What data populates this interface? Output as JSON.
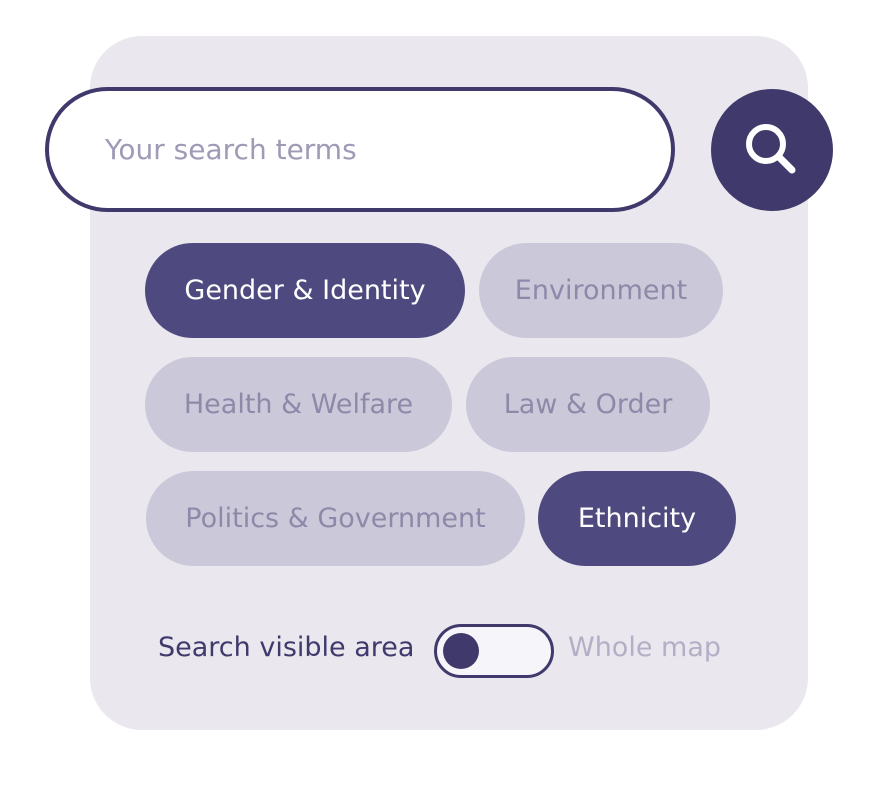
{
  "search": {
    "placeholder": "Your search terms",
    "value": "",
    "button_icon": "search-icon"
  },
  "categories": [
    {
      "label": "Gender & Identity",
      "selected": true
    },
    {
      "label": "Environment",
      "selected": false
    },
    {
      "label": "Health & Welfare",
      "selected": false
    },
    {
      "label": "Law & Order",
      "selected": false
    },
    {
      "label": "Politics & Government",
      "selected": false
    },
    {
      "label": "Ethnicity",
      "selected": true
    }
  ],
  "scope": {
    "left_label": "Search visible area",
    "right_label": "Whole map",
    "selected": "Search visible area"
  },
  "colors": {
    "primary": "#3f3a6b",
    "chip_active": "#4e4a7f",
    "chip_inactive": "#cbc9d9",
    "panel_bg": "#eae7ef"
  }
}
